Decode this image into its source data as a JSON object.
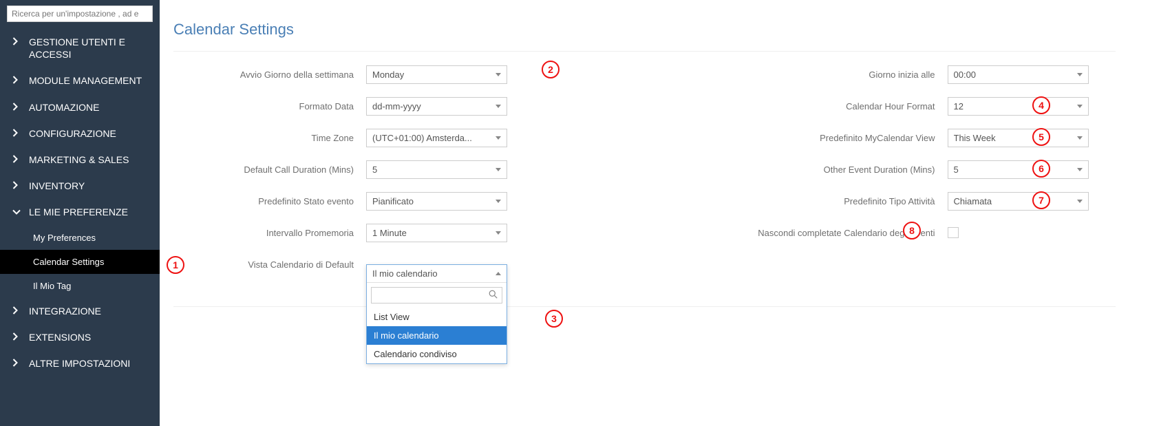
{
  "search": {
    "placeholder": "Ricerca per un'impostazione , ad e"
  },
  "sidebar": {
    "items": [
      {
        "label": "GESTIONE UTENTI E ACCESSI",
        "expanded": false
      },
      {
        "label": "MODULE MANAGEMENT",
        "expanded": false
      },
      {
        "label": "AUTOMAZIONE",
        "expanded": false
      },
      {
        "label": "CONFIGURAZIONE",
        "expanded": false
      },
      {
        "label": "MARKETING & SALES",
        "expanded": false
      },
      {
        "label": "INVENTORY",
        "expanded": false
      },
      {
        "label": "LE MIE PREFERENZE",
        "expanded": true,
        "children": [
          {
            "label": "My Preferences",
            "active": false
          },
          {
            "label": "Calendar Settings",
            "active": true
          },
          {
            "label": "Il Mio Tag",
            "active": false
          }
        ]
      },
      {
        "label": "INTEGRAZIONE",
        "expanded": false
      },
      {
        "label": "EXTENSIONS",
        "expanded": false
      },
      {
        "label": "ALTRE IMPOSTAZIONI",
        "expanded": false
      }
    ]
  },
  "page": {
    "title": "Calendar Settings"
  },
  "form": {
    "left": [
      {
        "label": "Avvio Giorno della settimana",
        "value": "Monday"
      },
      {
        "label": "Formato Data",
        "value": "dd-mm-yyyy"
      },
      {
        "label": "Time Zone",
        "value": "(UTC+01:00) Amsterda..."
      },
      {
        "label": "Default Call Duration (Mins)",
        "value": "5"
      },
      {
        "label": "Predefinito Stato evento",
        "value": "Pianificato"
      },
      {
        "label": "Intervallo Promemoria",
        "value": "1 Minute"
      },
      {
        "label": "Vista Calendario di Default",
        "value": "Il mio calendario"
      }
    ],
    "right": [
      {
        "label": "Giorno inizia alle",
        "value": "00:00"
      },
      {
        "label": "Calendar Hour Format",
        "value": "12"
      },
      {
        "label": "Predefinito MyCalendar View",
        "value": "This Week"
      },
      {
        "label": "Other Event Duration (Mins)",
        "value": "5"
      },
      {
        "label": "Predefinito Tipo Attività",
        "value": "Chiamata"
      },
      {
        "label": "Nascondi completate Calendario degli eventi",
        "type": "checkbox",
        "checked": false
      }
    ]
  },
  "dropdown": {
    "options": [
      {
        "label": "List View",
        "selected": false
      },
      {
        "label": "Il mio calendario",
        "selected": true
      },
      {
        "label": "Calendario condiviso",
        "selected": false
      }
    ]
  },
  "annotations": {
    "1": "1",
    "2": "2",
    "3": "3",
    "4": "4",
    "5": "5",
    "6": "6",
    "7": "7",
    "8": "8"
  }
}
